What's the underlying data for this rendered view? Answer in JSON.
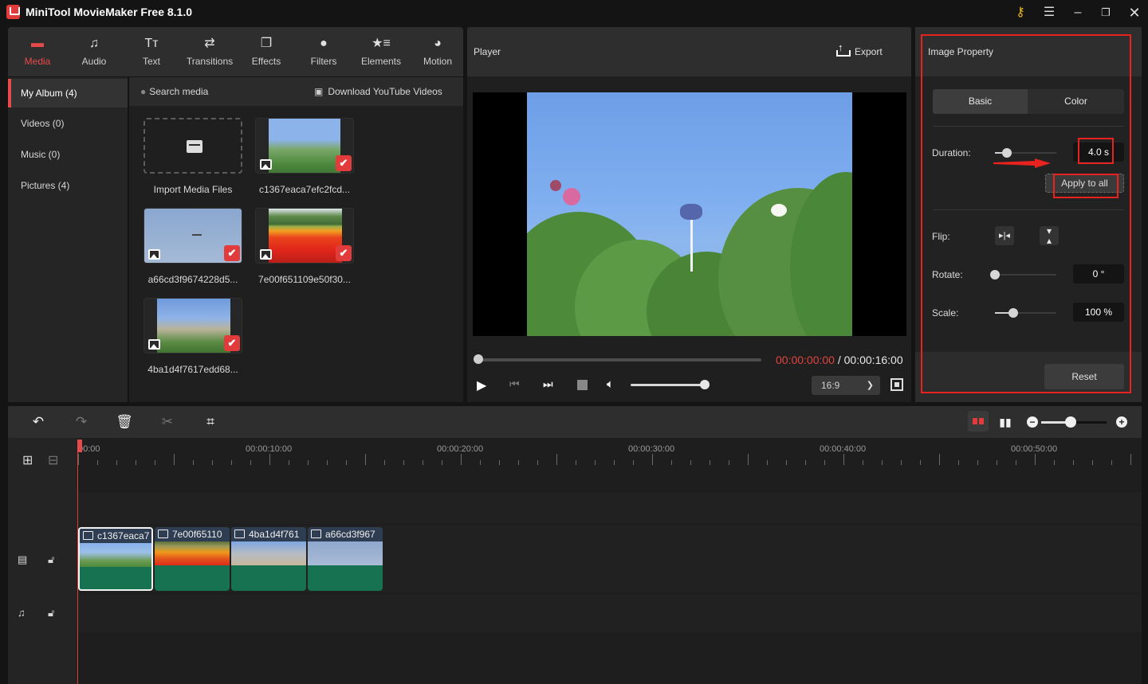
{
  "app": {
    "title": "MiniTool MovieMaker Free 8.1.0",
    "window_controls": [
      "key-icon",
      "menu-icon",
      "minimize-icon",
      "maximize-icon",
      "close-icon"
    ],
    "accent_color": "#e64a4a"
  },
  "tool_tabs": [
    {
      "label": "Media",
      "icon": "folder-icon",
      "active": true
    },
    {
      "label": "Audio",
      "icon": "music-note-icon",
      "active": false
    },
    {
      "label": "Text",
      "icon": "text-icon",
      "active": false
    },
    {
      "label": "Transitions",
      "icon": "swap-arrows-icon",
      "active": false
    },
    {
      "label": "Effects",
      "icon": "layers-icon",
      "active": false
    },
    {
      "label": "Filters",
      "icon": "filters-icon",
      "active": false
    },
    {
      "label": "Elements",
      "icon": "star-list-icon",
      "active": false
    },
    {
      "label": "Motion",
      "icon": "motion-icon",
      "active": false
    }
  ],
  "album": {
    "items": [
      {
        "label": "My Album (4)",
        "active": true
      },
      {
        "label": "Videos (0)",
        "active": false
      },
      {
        "label": "Music (0)",
        "active": false
      },
      {
        "label": "Pictures (4)",
        "active": false
      }
    ]
  },
  "media": {
    "search_placeholder": "Search media",
    "download_label": "Download YouTube Videos",
    "import_label": "Import Media Files",
    "files": [
      {
        "name": "c1367eaca7efc2fcd...",
        "selected": true
      },
      {
        "name": "a66cd3f9674228d5...",
        "selected": true
      },
      {
        "name": "7e00f651109e50f30...",
        "selected": true
      },
      {
        "name": "4ba1d4f7617edd68...",
        "selected": true
      }
    ]
  },
  "player": {
    "title": "Player",
    "export_label": "Export",
    "current_time": "00:00:00:00",
    "separator": " / ",
    "total_time": "00:00:16:00",
    "progress": 0,
    "volume": 1.0,
    "aspect_ratio": "16:9"
  },
  "properties": {
    "title": "Image Property",
    "tabs": [
      {
        "label": "Basic",
        "active": true
      },
      {
        "label": "Color",
        "active": false
      }
    ],
    "duration_label": "Duration:",
    "duration_value": "4.0 s",
    "apply_all_label": "Apply to all",
    "flip_label": "Flip:",
    "rotate_label": "Rotate:",
    "rotate_value": "0 °",
    "scale_label": "Scale:",
    "scale_value": "100 %",
    "reset_label": "Reset",
    "duration_slider": 0.2,
    "rotate_slider": 0.0,
    "scale_slider": 0.3
  },
  "timeline": {
    "toolbar": [
      "undo-icon",
      "redo-icon",
      "delete-icon",
      "split-icon",
      "crop-icon"
    ],
    "zoom_level": 0.45,
    "ruler_labels": [
      "00:00",
      "00:00:10:00",
      "00:00:20:00",
      "00:00:30:00",
      "00:00:40:00",
      "00:00:50:00"
    ],
    "clips": [
      {
        "label": "c1367eaca7",
        "selected": true
      },
      {
        "label": "7e00f65110",
        "selected": false
      },
      {
        "label": "4ba1d4f761",
        "selected": false
      },
      {
        "label": "a66cd3f967",
        "selected": false
      }
    ]
  }
}
